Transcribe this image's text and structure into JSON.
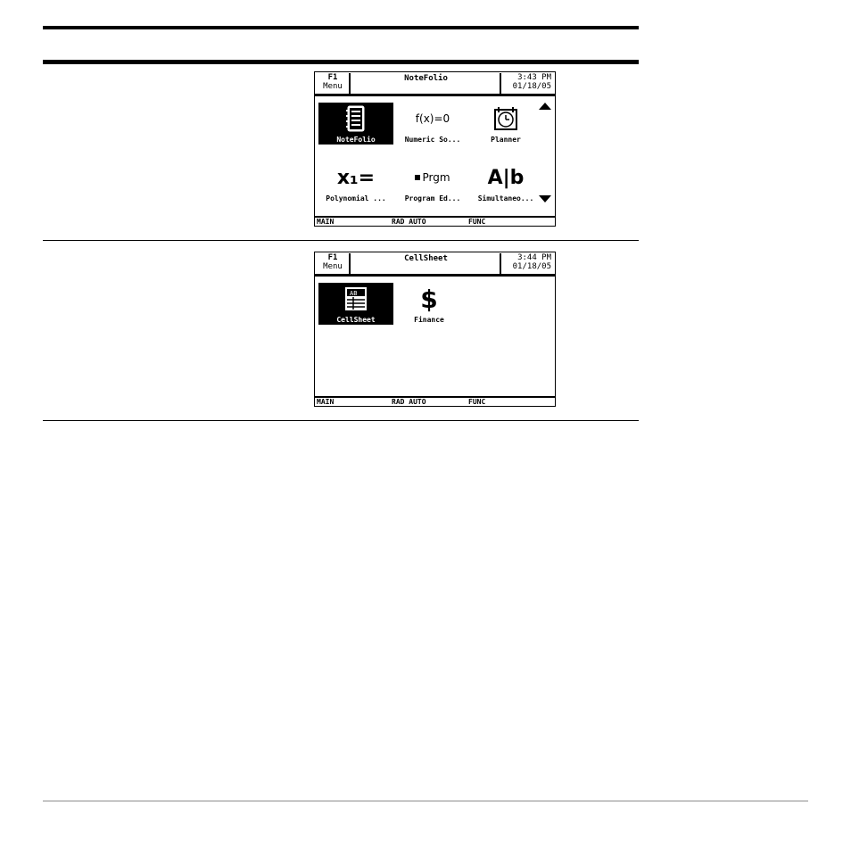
{
  "screens": [
    {
      "title": "NoteFolio",
      "f1_key": "F1",
      "f1_label": "Menu",
      "time": "3:43 PM",
      "date": "01/18/05",
      "apps": [
        {
          "label": "NoteFolio",
          "icon": "notebook-icon",
          "selected": true
        },
        {
          "label": "Numeric So...",
          "icon_text": "f(x)=0",
          "icon": "numeric-solver-icon"
        },
        {
          "label": "Planner",
          "icon": "planner-clock-icon"
        },
        {
          "label": "Polynomial ...",
          "icon_text": "x₁=",
          "icon": "polynomial-icon"
        },
        {
          "label": "Program Ed...",
          "icon_text": "Prgm",
          "icon": "program-editor-icon"
        },
        {
          "label": "Simultaneo...",
          "icon_text": "A|b",
          "icon": "simultaneous-icon"
        }
      ],
      "status": {
        "mode": "MAIN",
        "angle": "RAD AUTO",
        "graph": "FUNC"
      }
    },
    {
      "title": "CellSheet",
      "f1_key": "F1",
      "f1_label": "Menu",
      "time": "3:44 PM",
      "date": "01/18/05",
      "apps": [
        {
          "label": "CellSheet",
          "icon_text": "AB",
          "icon": "spreadsheet-icon",
          "selected": true
        },
        {
          "label": "Finance",
          "icon_text": "$",
          "icon": "dollar-icon"
        }
      ],
      "status": {
        "mode": "MAIN",
        "angle": "RAD AUTO",
        "graph": "FUNC"
      }
    }
  ]
}
